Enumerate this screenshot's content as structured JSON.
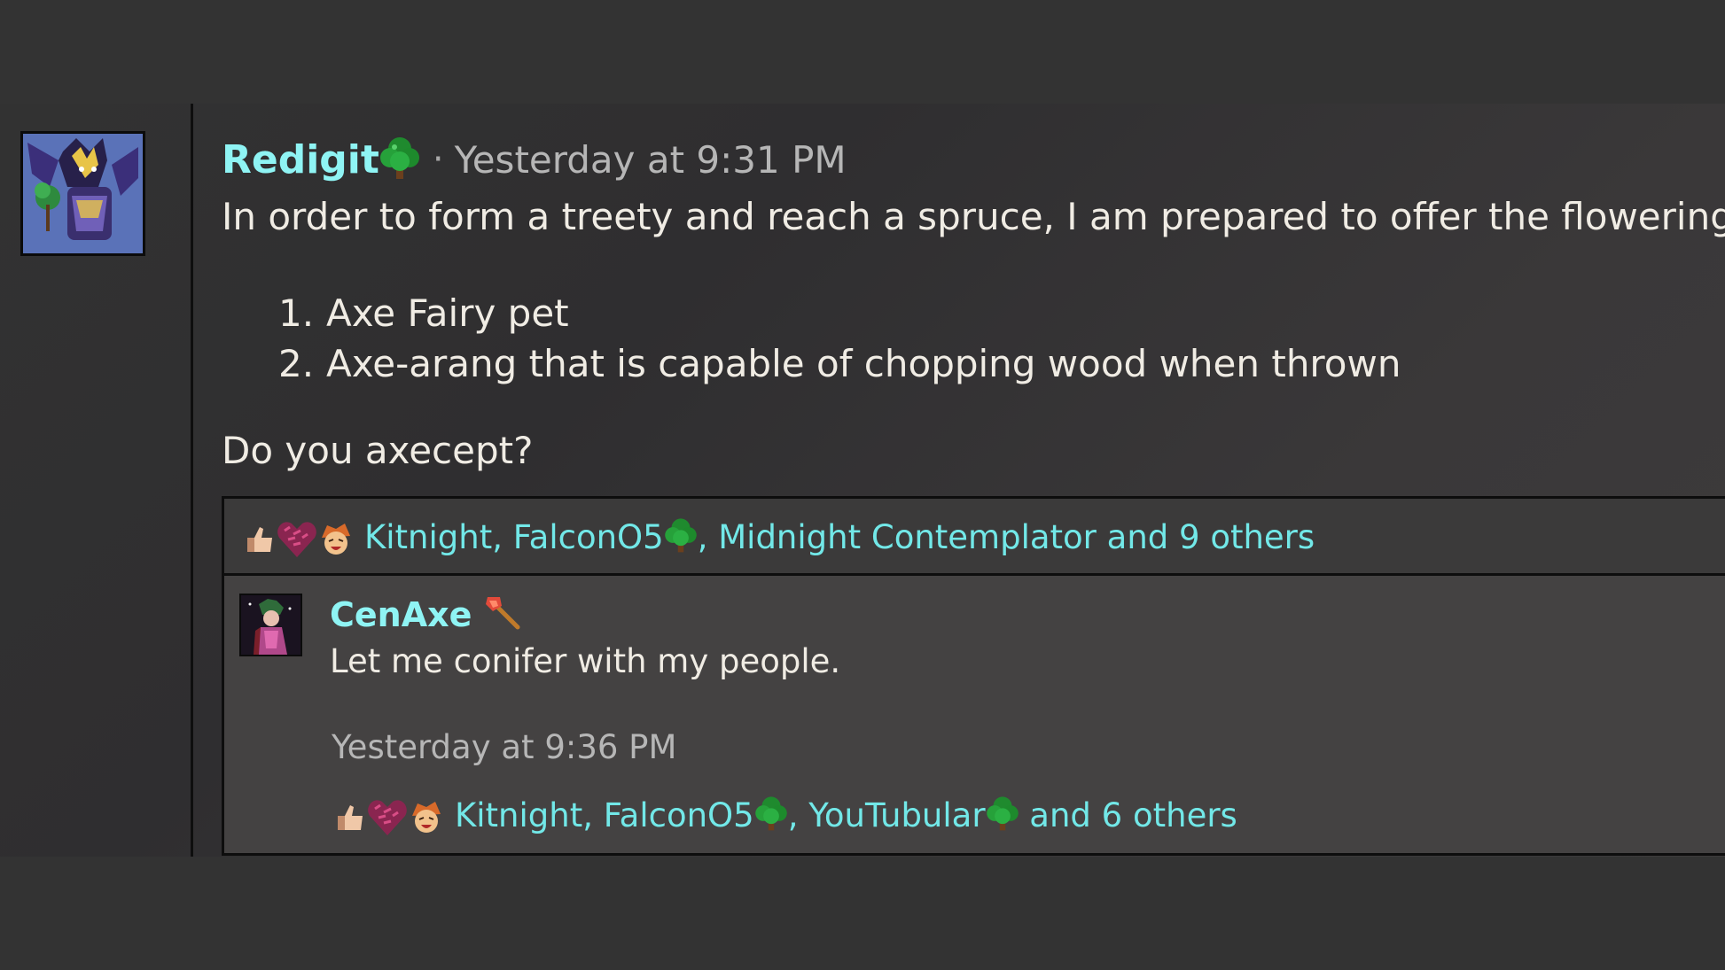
{
  "post": {
    "username": "Redigit",
    "username_emoji": "tree-icon",
    "separator": "·",
    "timestamp": "Yesterday at 9:31 PM",
    "body": "In order to form a treety and reach a spruce, I am prepared to offer the flowering:",
    "list": [
      {
        "num": "1.",
        "text": "Axe Fairy pet"
      },
      {
        "num": "2.",
        "text": "Axe-arang that is capable of chopping wood when thrown"
      }
    ],
    "question": "Do you axecept?",
    "reactions": {
      "icons": [
        "thumbs-up-icon",
        "heart-icon",
        "laughing-face-icon"
      ],
      "name1": "Kitnight",
      "sep1": ", ",
      "name2": "FalconO5",
      "sep2": ", ",
      "name3": "Midnight Contemplator",
      "rest": " and 9 others"
    }
  },
  "reply": {
    "username": "CenAxe",
    "username_emoji": "axe-icon",
    "body": "Let me conifer with my people.",
    "timestamp": "Yesterday at 9:36 PM",
    "reactions": {
      "icons": [
        "thumbs-up-icon",
        "heart-icon",
        "laughing-face-icon"
      ],
      "name1": "Kitnight",
      "sep1": ", ",
      "name2": "FalconO5",
      "sep2": ", ",
      "name3": "YouTubular",
      "rest": " and 6 others"
    }
  },
  "colors": {
    "username": "#8ff4f4",
    "link": "#72e8e8",
    "text": "#f0ece4",
    "muted": "#b6b6b6",
    "background": "#333333"
  }
}
